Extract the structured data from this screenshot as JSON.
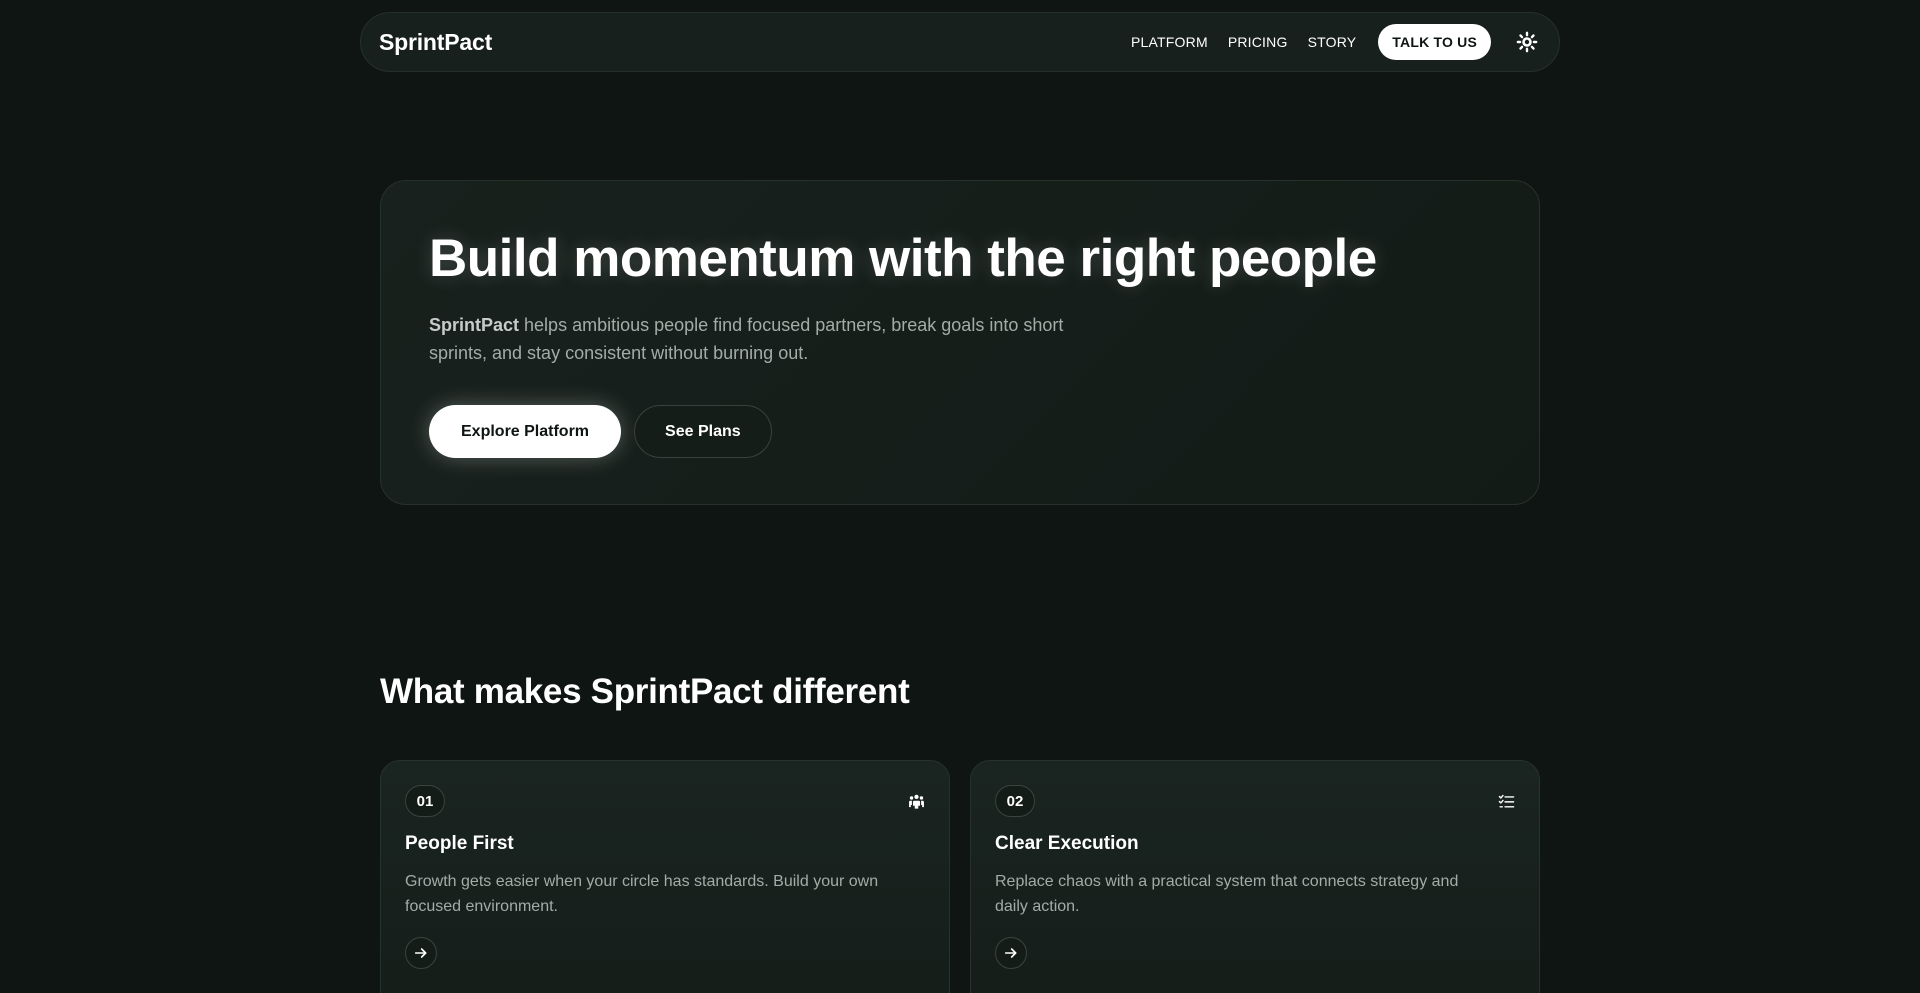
{
  "nav": {
    "brand": "SprintPact",
    "links": [
      "PLATFORM",
      "PRICING",
      "STORY"
    ],
    "cta": "TALK TO US",
    "theme_icon": "sun-icon"
  },
  "hero": {
    "title": "Build momentum with the right people",
    "desc_brand": "SprintPact",
    "desc_rest": " helps ambitious people find focused partners, break goals into short sprints, and stay consistent without burning out.",
    "primary_button": "Explore Platform",
    "secondary_button": "See Plans"
  },
  "features": {
    "title": "What makes SprintPact different",
    "cards": [
      {
        "number": "01",
        "icon": "people-group-icon",
        "title": "People First",
        "text": "Growth gets easier when your circle has standards. Build your own focused environment."
      },
      {
        "number": "02",
        "icon": "checklist-icon",
        "title": "Clear Execution",
        "text": "Replace chaos with a practical system that connects strategy and daily action."
      }
    ]
  },
  "colors": {
    "background": "#0e1512",
    "surface": "#17201c",
    "text_muted": "#a4aca8",
    "accent": "#ffffff"
  }
}
